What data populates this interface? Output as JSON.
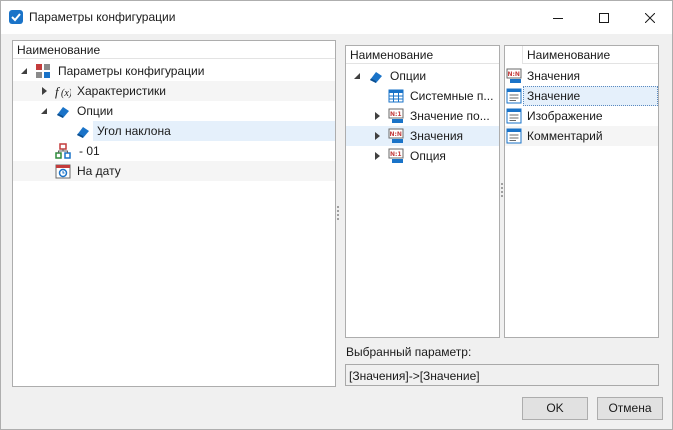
{
  "window": {
    "title": "Параметры конфигурации"
  },
  "left_panel": {
    "header": "Наименование",
    "items": [
      {
        "label": "Параметры конфигурации",
        "icon": "config-grid-icon",
        "expanded": true
      },
      {
        "label": "Характеристики",
        "icon": "function-icon",
        "expanded": false
      },
      {
        "label": "Опции",
        "icon": "option-book-icon",
        "expanded": true
      },
      {
        "label": "Угол наклона",
        "icon": "option-book-icon",
        "selected": true
      },
      {
        "label": "- 01",
        "icon": "hierarchy-icon"
      },
      {
        "label": "На дату",
        "icon": "calendar-icon"
      }
    ]
  },
  "middle_panel": {
    "header": "Наименование",
    "items": [
      {
        "label": "Опции",
        "icon": "option-book-icon",
        "expanded": true
      },
      {
        "label": "Системные п...",
        "icon": "table-icon"
      },
      {
        "label": "Значение по...",
        "icon": "n1-relation-icon",
        "expanded": false
      },
      {
        "label": "Значения",
        "icon": "nn-relation-icon",
        "expanded": false,
        "selected": true
      },
      {
        "label": "Опция",
        "icon": "n1-relation-icon",
        "expanded": false
      }
    ]
  },
  "right_panel": {
    "header": "Наименование",
    "items": [
      {
        "label": "Значения",
        "icon": "nn-relation-icon"
      },
      {
        "label": "Значение",
        "icon": "field-icon",
        "selected": true
      },
      {
        "label": "Изображение",
        "icon": "field-icon"
      },
      {
        "label": "Комментарий",
        "icon": "field-icon"
      }
    ]
  },
  "selected_parameter": {
    "label": "Выбранный параметр:",
    "value": "[Значения]->[Значение]"
  },
  "buttons": {
    "ok": "OK",
    "cancel": "Отмена"
  },
  "colors": {
    "selection": "#e5f0fb",
    "accent": "#1a73c8",
    "button_face": "#e1e1e1"
  }
}
